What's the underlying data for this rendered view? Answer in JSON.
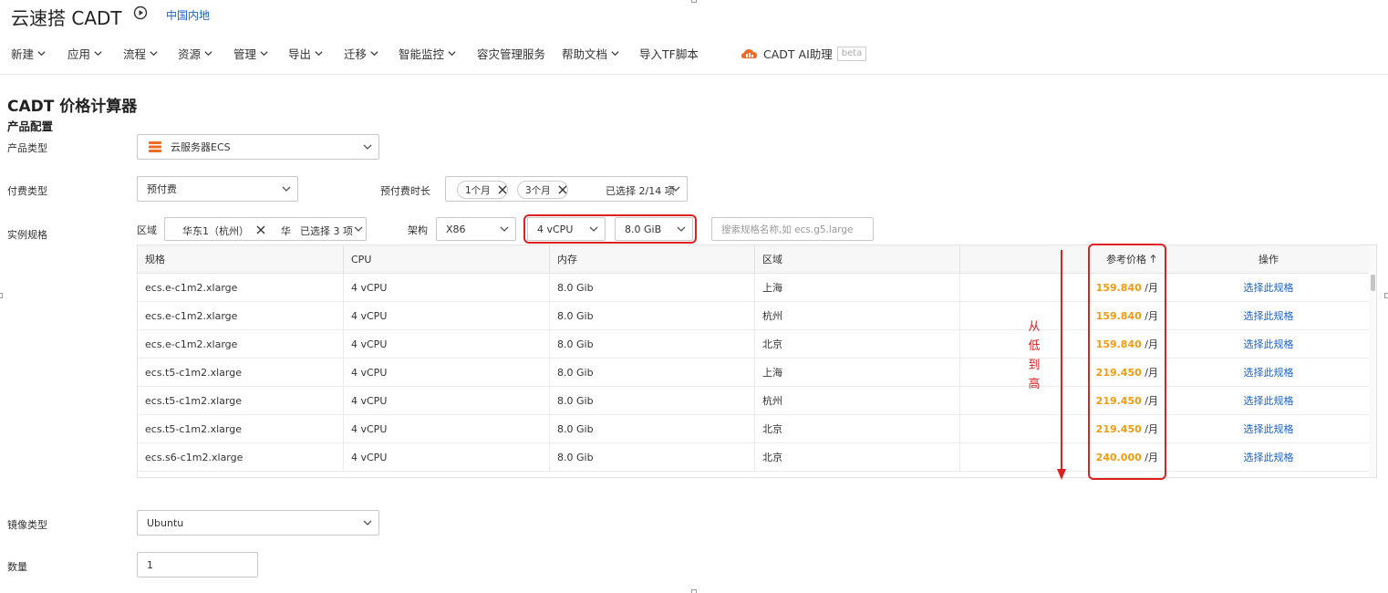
{
  "header": {
    "app_title": "云速搭 CADT",
    "region": "中国内地",
    "nav": [
      "新建",
      "应用",
      "流程",
      "资源",
      "管理",
      "导出",
      "迁移",
      "智能监控",
      "容灾管理服务",
      "帮助文档",
      "导入TF脚本"
    ],
    "ai_assistant": "CADT AI助理",
    "beta": "beta"
  },
  "page": {
    "title": "CADT 价格计算器",
    "section": "产品配置"
  },
  "form": {
    "product_type": {
      "label": "产品类型",
      "value": "云服务器ECS",
      "icon": "ecs-server-icon"
    },
    "pay_type": {
      "label": "付费类型",
      "value": "预付费"
    },
    "prepay_duration": {
      "label": "预付费时长",
      "tags": [
        "1个月",
        "3个月"
      ],
      "summary": "已选择 2/14 项"
    },
    "instance_spec": {
      "label": "实例规格",
      "region_label": "区域",
      "region_tag": "华东1（杭州）",
      "region_partial": "华",
      "region_summary": "已选择 3 项",
      "arch_label": "架构",
      "arch_value": "X86",
      "cpu_value": "4 vCPU",
      "mem_value": "8.0 GiB",
      "search_placeholder": "搜索规格名称,如 ecs.g5.large"
    },
    "image_type": {
      "label": "镜像类型",
      "value": "Ubuntu"
    },
    "quantity": {
      "label": "数量",
      "value": "1"
    }
  },
  "table": {
    "columns": [
      "规格",
      "CPU",
      "内存",
      "区域",
      "",
      "参考价格",
      "操作"
    ],
    "sort_icon": "sort-up-arrow-icon",
    "price_unit": "/月",
    "action_label": "选择此规格",
    "rows": [
      {
        "spec": "ecs.e-c1m2.xlarge",
        "cpu": "4 vCPU",
        "mem": "8.0 Gib",
        "region": "上海",
        "price": "159.840"
      },
      {
        "spec": "ecs.e-c1m2.xlarge",
        "cpu": "4 vCPU",
        "mem": "8.0 Gib",
        "region": "杭州",
        "price": "159.840"
      },
      {
        "spec": "ecs.e-c1m2.xlarge",
        "cpu": "4 vCPU",
        "mem": "8.0 Gib",
        "region": "北京",
        "price": "159.840"
      },
      {
        "spec": "ecs.t5-c1m2.xlarge",
        "cpu": "4 vCPU",
        "mem": "8.0 Gib",
        "region": "上海",
        "price": "219.450"
      },
      {
        "spec": "ecs.t5-c1m2.xlarge",
        "cpu": "4 vCPU",
        "mem": "8.0 Gib",
        "region": "杭州",
        "price": "219.450"
      },
      {
        "spec": "ecs.t5-c1m2.xlarge",
        "cpu": "4 vCPU",
        "mem": "8.0 Gib",
        "region": "北京",
        "price": "219.450"
      },
      {
        "spec": "ecs.s6-c1m2.xlarge",
        "cpu": "4 vCPU",
        "mem": "8.0 Gib",
        "region": "北京",
        "price": "240.000"
      }
    ]
  },
  "annotation": {
    "text": "从低到高",
    "color": "#e02020"
  },
  "colors": {
    "price": "#f29b0e",
    "link": "#1a62c9",
    "highlight": "#e02020",
    "ecs_icon": "#f06a24"
  }
}
